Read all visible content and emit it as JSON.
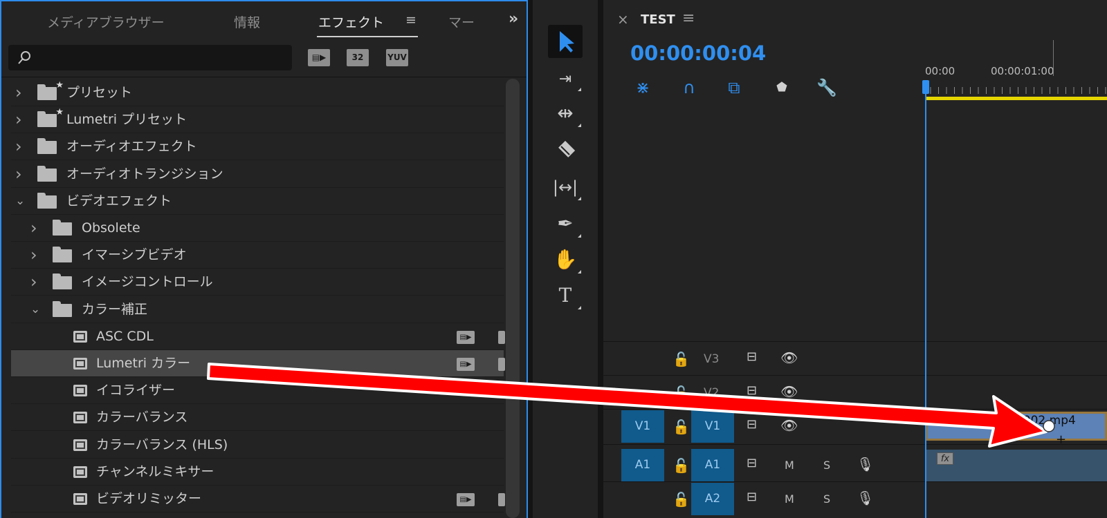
{
  "effects_panel": {
    "tabs": [
      "メディアブラウザー",
      "情報",
      "エフェクト",
      "マー"
    ],
    "active_tab": "エフェクト",
    "overflow": "»",
    "menu_icon": "≡",
    "search_placeholder": "",
    "toolbar_buttons": [
      "accelerated-icon",
      "32",
      "YUV"
    ],
    "tree": [
      {
        "label": "プリセット",
        "type": "folder-preset",
        "expanded": false
      },
      {
        "label": "Lumetri プリセット",
        "type": "folder-preset",
        "expanded": false
      },
      {
        "label": "オーディオエフェクト",
        "type": "folder",
        "expanded": false
      },
      {
        "label": "オーディオトランジション",
        "type": "folder",
        "expanded": false
      },
      {
        "label": "ビデオエフェクト",
        "type": "folder",
        "expanded": true
      },
      {
        "label": "Obsolete",
        "type": "folder",
        "expanded": false
      },
      {
        "label": "イマーシブビデオ",
        "type": "folder",
        "expanded": false
      },
      {
        "label": "イメージコントロール",
        "type": "folder",
        "expanded": false
      },
      {
        "label": "カラー補正",
        "type": "folder",
        "expanded": true
      },
      {
        "label": "ASC CDL",
        "type": "effect"
      },
      {
        "label": "Lumetri カラー",
        "type": "effect",
        "selected": true
      },
      {
        "label": "イコライザー",
        "type": "effect"
      },
      {
        "label": "カラーバランス",
        "type": "effect"
      },
      {
        "label": "カラーバランス (HLS)",
        "type": "effect"
      },
      {
        "label": "チャンネルミキサー",
        "type": "effect"
      },
      {
        "label": "ビデオリミッター",
        "type": "effect"
      }
    ]
  },
  "tools": [
    "selection-tool",
    "track-select-forward-tool",
    "ripple-edit-tool",
    "razor-tool",
    "slip-tool",
    "pen-tool",
    "hand-tool",
    "type-tool"
  ],
  "timeline": {
    "sequence_name": "TEST",
    "close_glyph": "×",
    "menu_glyph": "≡",
    "timecode": "00:00:00:04",
    "ruler_labels": [
      "00:00",
      "00:00:01:00"
    ],
    "tracks": [
      {
        "name": "V3",
        "source": "",
        "kind": "video"
      },
      {
        "name": "V2",
        "source": "",
        "kind": "video"
      },
      {
        "name": "V1",
        "source": "V1",
        "kind": "video",
        "targeted": true
      },
      {
        "name": "A1",
        "source": "A1",
        "kind": "audio",
        "targeted": true
      },
      {
        "name": "A2",
        "source": "",
        "kind": "audio",
        "targeted": true
      }
    ],
    "audio_buttons": {
      "mute": "M",
      "solo": "S"
    },
    "clip": {
      "name": "TEST_FILE002.mp4",
      "track": "V1"
    },
    "fx_badge": "fx"
  },
  "colors": {
    "accent": "#2f8ff0",
    "arrow": "#ff0000",
    "work_area": "#e6d600",
    "clip_video": "#5c82b8"
  }
}
